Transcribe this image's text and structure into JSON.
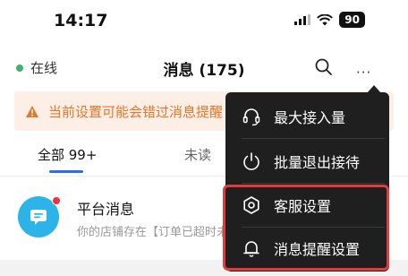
{
  "status_bar": {
    "time": "14:17",
    "battery": "90"
  },
  "header": {
    "status_label": "在线",
    "title": "消息 (175)",
    "search_icon": "search-icon",
    "more_icon": "more-icon",
    "more_label": "···"
  },
  "banner": {
    "text": "当前设置可能会错过消息提醒",
    "icon": "warning-icon"
  },
  "tabs": [
    {
      "label": "全部 99+",
      "active": true
    },
    {
      "label": "未读",
      "active": false
    }
  ],
  "messages": [
    {
      "title": "平台消息",
      "preview": "你的店铺存在【订单已超时未发货】"
    }
  ],
  "menu": {
    "items": [
      {
        "label": "最大接入量",
        "icon": "headset-icon"
      },
      {
        "label": "批量退出接待",
        "icon": "power-icon"
      },
      {
        "label": "客服设置",
        "icon": "settings-icon"
      },
      {
        "label": "消息提醒设置",
        "icon": "bell-icon"
      }
    ]
  },
  "colors": {
    "accent": "#2b6cf6",
    "online": "#3cb371",
    "warning": "#e8752a",
    "popup_bg": "#1f1f1f",
    "highlight": "#e23b3b",
    "avatar": "#2cb3e8",
    "unread_dot": "#f0303c"
  }
}
